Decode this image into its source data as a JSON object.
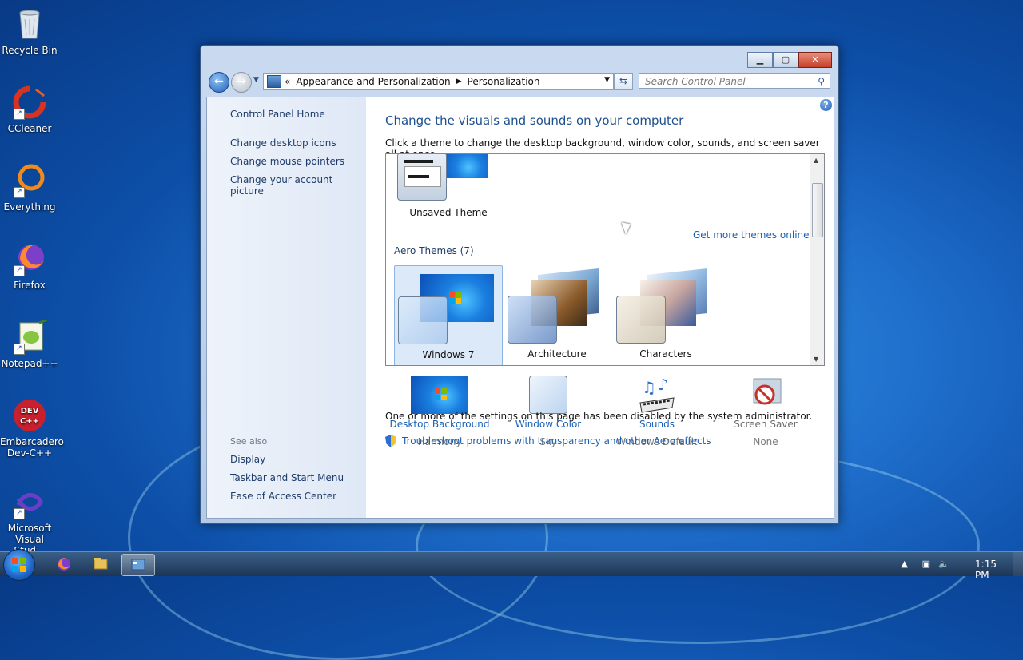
{
  "desktop": {
    "icons": [
      {
        "label": "Recycle Bin",
        "icon": "recycle-bin-icon"
      },
      {
        "label": "CCleaner",
        "icon": "ccleaner-icon"
      },
      {
        "label": "Everything",
        "icon": "everything-icon"
      },
      {
        "label": "Firefox",
        "icon": "firefox-icon"
      },
      {
        "label": "Notepad++",
        "icon": "notepad-plus-plus-icon"
      },
      {
        "label": "Embarcadero\nDev-C++",
        "icon": "devcpp-icon"
      },
      {
        "label": "Microsoft\nVisual Stud...",
        "icon": "visual-studio-icon"
      }
    ]
  },
  "window": {
    "breadcrumb": {
      "chevrons": "«",
      "items": [
        "Appearance and Personalization",
        "Personalization"
      ]
    },
    "search_placeholder": "Search Control Panel",
    "sidebar": {
      "home": "Control Panel Home",
      "links": [
        "Change desktop icons",
        "Change mouse pointers",
        "Change your account picture"
      ],
      "see_also_label": "See also",
      "see_also": [
        "Display",
        "Taskbar and Start Menu",
        "Ease of Access Center"
      ]
    },
    "main": {
      "title": "Change the visuals and sounds on your computer",
      "subtitle": "Click a theme to change the desktop background, window color, sounds, and screen saver all at once.",
      "unsaved_theme": "Unsaved Theme",
      "get_more": "Get more themes online",
      "aero_group": "Aero Themes (7)",
      "aero_themes": [
        "Windows 7",
        "Architecture",
        "Characters"
      ],
      "settings": [
        {
          "label": "Desktop Background",
          "value": "Harmony",
          "disabled": false
        },
        {
          "label": "Window Color",
          "value": "Sky",
          "disabled": false
        },
        {
          "label": "Sounds",
          "value": "Windows Default",
          "disabled": false
        },
        {
          "label": "Screen Saver",
          "value": "None",
          "disabled": true
        }
      ],
      "note": "One or more of the settings on this page has been disabled by the system administrator.",
      "troubleshoot": "Troubleshoot problems with transparency and other Aero effects"
    }
  },
  "taskbar": {
    "clock": "1:15 PM"
  },
  "colors": {
    "link": "#1a5fb4",
    "title": "#1e4f8f",
    "selected": "#dce9f8"
  }
}
